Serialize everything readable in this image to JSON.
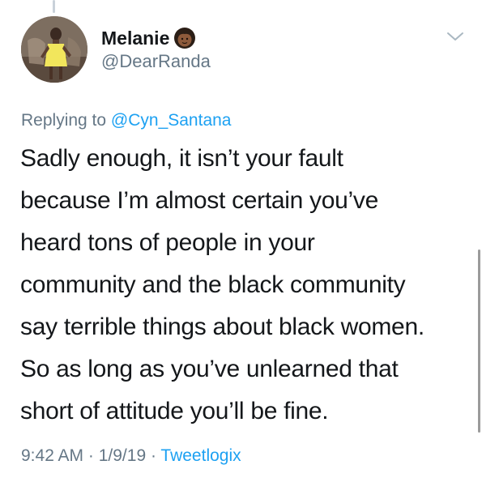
{
  "tweet": {
    "author": {
      "display_name": "Melanie",
      "emoji_icon": "woman-emoji-icon",
      "handle": "@DearRanda"
    },
    "reply_context": {
      "prefix": "Replying to ",
      "mention": "@Cyn_Santana"
    },
    "text_lines": [
      "Sadly enough, it isn’t your fault",
      "because I’m almost certain you’ve",
      "heard tons of people in your",
      "community and the black community",
      "say terrible things about black women.",
      "So as long as you’ve unlearned that",
      "short of attitude you’ll be fine."
    ],
    "meta": {
      "time": "9:42 AM",
      "separator": " · ",
      "date": "1/9/19",
      "source": "Tweetlogix"
    },
    "menu_icon": "chevron-down-icon"
  },
  "colors": {
    "text_primary": "#14171a",
    "text_secondary": "#657786",
    "link_blue": "#1da1f2",
    "thread_line": "#c9d1d9"
  }
}
